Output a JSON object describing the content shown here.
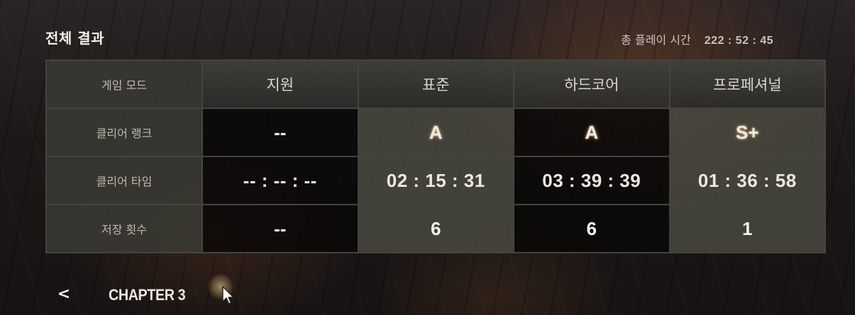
{
  "header": {
    "title": "전체 결과",
    "playtime_label": "총 플레이 시간",
    "playtime_value": "222 : 52 : 45"
  },
  "table": {
    "corner_label": "게임 모드",
    "modes": [
      "지원",
      "표준",
      "하드코어",
      "프로페셔널"
    ],
    "rows": [
      {
        "label": "클리어 랭크",
        "values": [
          "--",
          "A",
          "A",
          "S+"
        ]
      },
      {
        "label": "클리어 타임",
        "values": [
          "-- : -- : --",
          "02 : 15 : 31",
          "03 : 39 : 39",
          "01 : 36 : 58"
        ]
      },
      {
        "label": "저장 횟수",
        "values": [
          "--",
          "6",
          "6",
          "1"
        ]
      }
    ]
  },
  "footer": {
    "back_icon": "chevron-left-icon",
    "back_glyph": "<",
    "chapter_label": "CHAPTER 3"
  },
  "colors": {
    "text": "#e8e4dc",
    "rank_glow": "#f3e9d6"
  }
}
